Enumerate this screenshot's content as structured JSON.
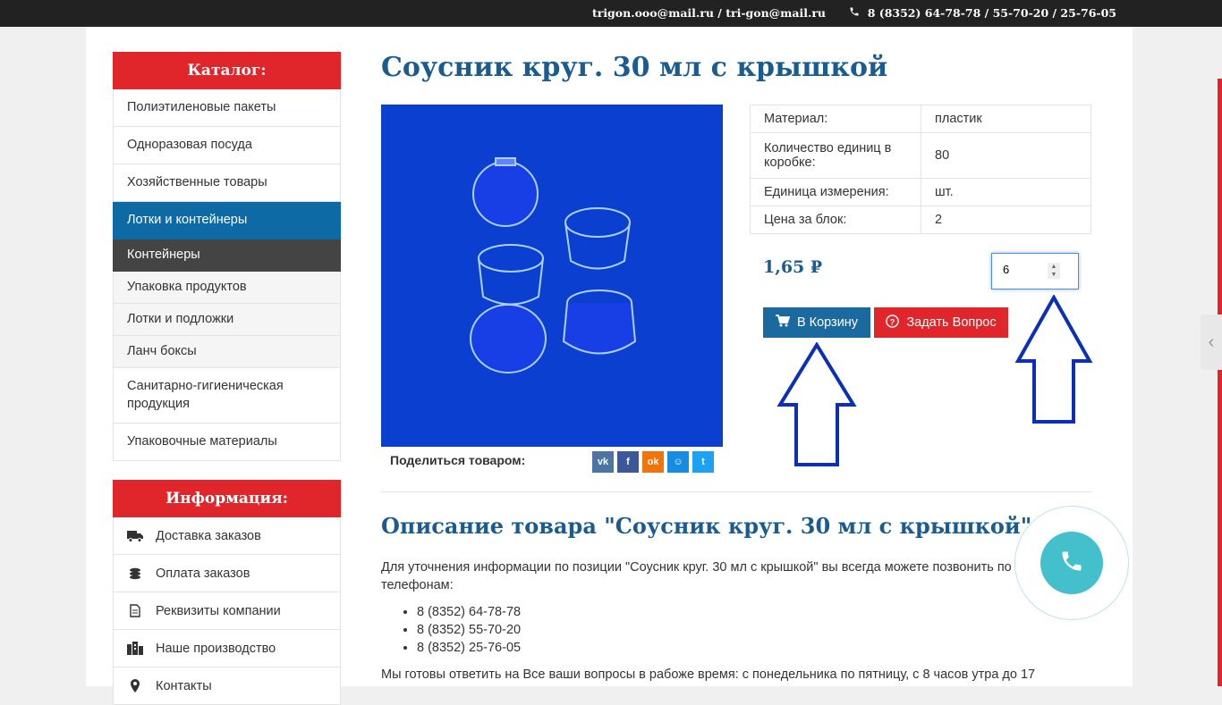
{
  "topbar": {
    "emails": "trigon.ooo@mail.ru / tri-gon@mail.ru",
    "phones": "8 (8352) 64-78-78  / 55-70-20  / 25-76-05"
  },
  "sidebar": {
    "catalog_title": "Каталог:",
    "categories": [
      "Полиэтиленовые пакеты",
      "Одноразовая посуда",
      "Хозяйственные товары",
      "Лотки и контейнеры"
    ],
    "subcategories": [
      "Контейнеры",
      "Упаковка продуктов",
      "Лотки и подложки",
      "Ланч боксы"
    ],
    "categories_after": [
      "Санитарно-гигиеническая продукция",
      "Упаковочные материалы"
    ],
    "info_title": "Информация:",
    "info_items": [
      "Доставка заказов",
      "Оплата заказов",
      "Реквизиты компании",
      "Наше производство",
      "Контакты"
    ]
  },
  "product": {
    "title": "Соусник круг. 30 мл с крышкой",
    "share_label": "Поделиться товаром:",
    "share_icons": [
      "vk-icon",
      "facebook-icon",
      "odnoklassniki-icon",
      "moimir-icon",
      "twitter-icon"
    ],
    "specs": [
      {
        "label": "Материал:",
        "value": "пластик"
      },
      {
        "label": "Количество единиц в коробке:",
        "value": "80"
      },
      {
        "label": "Единица измерения:",
        "value": "шт."
      },
      {
        "label": "Цена за блок:",
        "value": "2"
      }
    ],
    "price": "1,65 ₽",
    "quantity": "6",
    "cart_button": "В Корзину",
    "ask_button": "Задать Вопрос"
  },
  "description": {
    "title": "Описание товара \"Соусник круг. 30 мл с крышкой\"",
    "intro": "Для уточнения информации по позиции \"Соусник круг. 30 мл с крышкой\" вы всегда можете позвонить по телефонам:",
    "phones": [
      "8 (8352) 64-78-78",
      "8 (8352) 55-70-20",
      "8 (8352) 25-76-05"
    ],
    "outro": "Мы готовы ответить на Все ваши вопросы в рабоже время: с понедельника по пятницу, с 8 часов утра до 17"
  },
  "colors": {
    "brand_red": "#e0262b",
    "brand_blue": "#1a5c8f",
    "active_blue": "#0d6aa5",
    "image_blue": "#0a3fd0",
    "call_teal": "#44c0cc"
  }
}
